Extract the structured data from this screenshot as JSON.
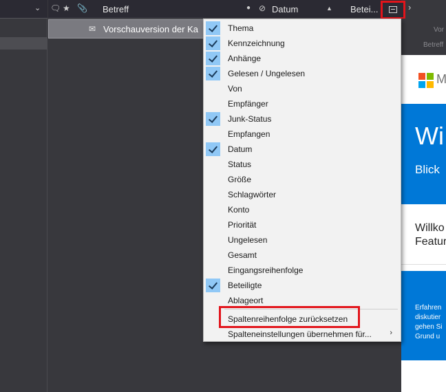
{
  "header": {
    "subject_col": "Betreff",
    "date_col": "Datum",
    "participants_col": "Betei...",
    "sort_indicator": "▲"
  },
  "message": {
    "subject": "Vorschauversion der Ka"
  },
  "preview": {
    "meta_from": "Vor",
    "meta_subject": "Betreff",
    "brand_partial": "M",
    "hero_title": "Wi",
    "hero_subtitle": "Blick",
    "welcome_line1": "Willko",
    "welcome_line2": "Featur",
    "body_lines": [
      "Erfahren",
      "diskutier",
      "gehen Si",
      "Grund u"
    ]
  },
  "menu": {
    "items": [
      {
        "label": "Thema",
        "checked": true
      },
      {
        "label": "Kennzeichnung",
        "checked": true
      },
      {
        "label": "Anhänge",
        "checked": true
      },
      {
        "label": "Gelesen / Ungelesen",
        "checked": true
      },
      {
        "label": "Von",
        "checked": false
      },
      {
        "label": "Empfänger",
        "checked": false
      },
      {
        "label": "Junk-Status",
        "checked": true
      },
      {
        "label": "Empfangen",
        "checked": false
      },
      {
        "label": "Datum",
        "checked": true
      },
      {
        "label": "Status",
        "checked": false
      },
      {
        "label": "Größe",
        "checked": false
      },
      {
        "label": "Schlagwörter",
        "checked": false
      },
      {
        "label": "Konto",
        "checked": false
      },
      {
        "label": "Priorität",
        "checked": false
      },
      {
        "label": "Ungelesen",
        "checked": false
      },
      {
        "label": "Gesamt",
        "checked": false
      },
      {
        "label": "Eingangsreihenfolge",
        "checked": false
      },
      {
        "label": "Beteiligte",
        "checked": true
      },
      {
        "label": "Ablageort",
        "checked": false
      }
    ],
    "reset_order": "Spaltenreihenfolge zurücksetzen",
    "apply_settings": "Spalteneinstellungen übernehmen für...",
    "submenu_arrow": "›"
  },
  "colors": {
    "highlight_red": "#e2141b",
    "check_blue": "#90c8f6",
    "brand_blue": "#0078d7"
  }
}
